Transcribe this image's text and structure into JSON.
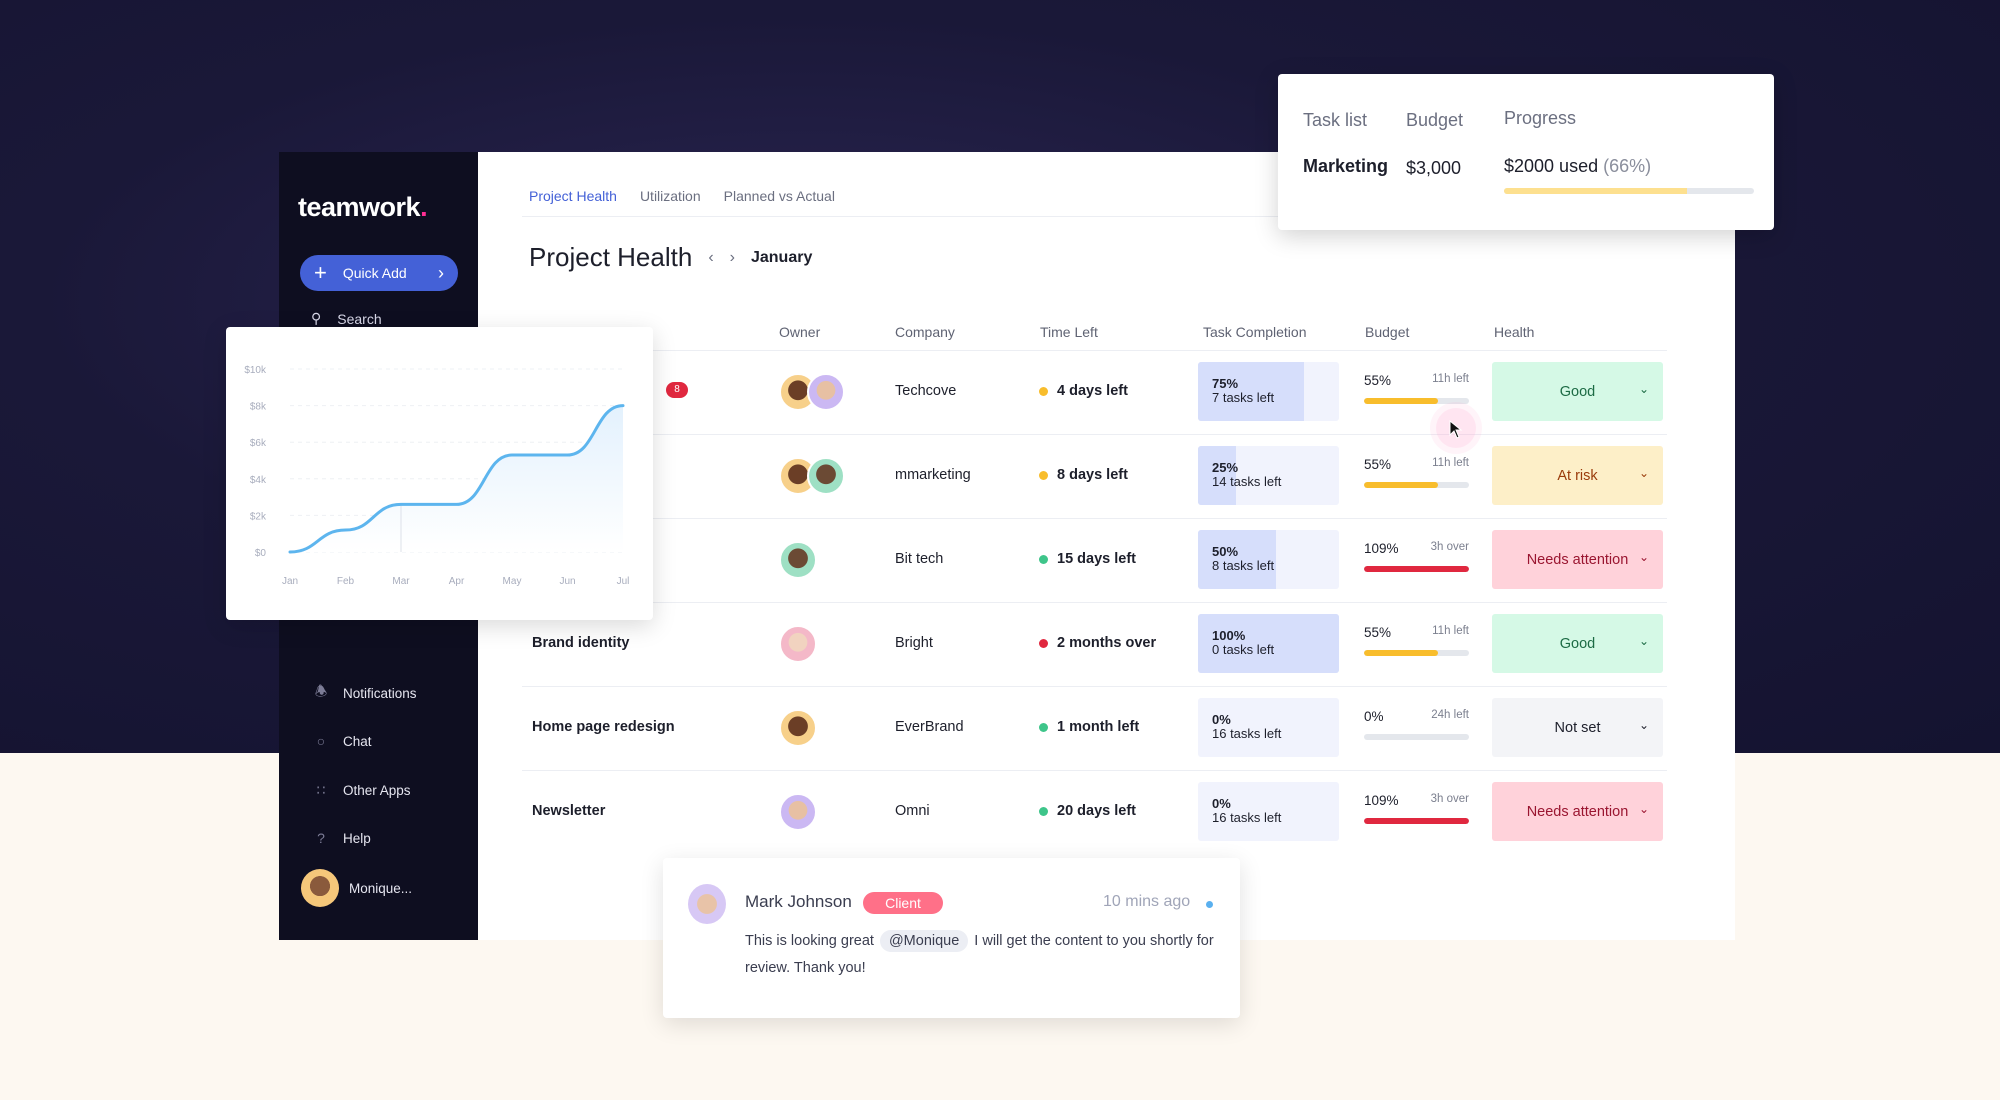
{
  "sidebar": {
    "logo": "teamwork",
    "logo_dot": ".",
    "quick_add": "Quick Add",
    "search": "Search",
    "items": [
      {
        "label": "Notifications",
        "icon": "bell-icon"
      },
      {
        "label": "Chat",
        "icon": "chat-icon"
      },
      {
        "label": "Other Apps",
        "icon": "grid-icon"
      },
      {
        "label": "Help",
        "icon": "help-icon"
      }
    ],
    "user": "Monique..."
  },
  "tabs": [
    {
      "label": "Project Health",
      "active": true
    },
    {
      "label": "Utilization"
    },
    {
      "label": "Planned vs Actual"
    }
  ],
  "title": "Project Health",
  "period": "January",
  "table": {
    "headers": [
      "Owner",
      "Company",
      "Time Left",
      "Task Completion",
      "Budget",
      "Health"
    ],
    "rows": [
      {
        "name": "",
        "badge": "8",
        "owners": 2,
        "company": "Techcove",
        "time": "4 days left",
        "time_color": "#f8bd2c",
        "tc_pct": "75%",
        "tc_fill": 75,
        "tc_left": "7 tasks left",
        "budget_pct": "55%",
        "budget_fill": 70,
        "budget_note": "11h left",
        "budget_color": "#f8bd2c",
        "health": "Good",
        "health_bg": "#d5f9e6",
        "health_fg": "#1c6b44"
      },
      {
        "name": "",
        "owners": 2,
        "company": "mmarketing",
        "time": "8 days left",
        "time_color": "#f8bd2c",
        "tc_pct": "25%",
        "tc_fill": 27,
        "tc_left": "14 tasks left",
        "budget_pct": "55%",
        "budget_fill": 70,
        "budget_note": "11h left",
        "budget_color": "#f8bd2c",
        "health": "At risk",
        "health_bg": "#fdefc8",
        "health_fg": "#9a3b0a"
      },
      {
        "name": "",
        "owners": 1,
        "company": "Bit tech",
        "time": "15 days left",
        "time_color": "#3ec58a",
        "tc_pct": "50%",
        "tc_fill": 55,
        "tc_left": "8 tasks left",
        "budget_pct": "109%",
        "budget_fill": 100,
        "budget_note": "3h over",
        "budget_color": "#e0283f",
        "health": "Needs attention",
        "health_bg": "#ffd2da",
        "health_fg": "#9a1530"
      },
      {
        "name": "Brand identity",
        "owners": 1,
        "company": "Bright",
        "time": "2 months over",
        "time_color": "#e0283f",
        "tc_pct": "100%",
        "tc_fill": 100,
        "tc_left": "0 tasks left",
        "budget_pct": "55%",
        "budget_fill": 70,
        "budget_note": "11h left",
        "budget_color": "#f8bd2c",
        "health": "Good",
        "health_bg": "#d5f9e6",
        "health_fg": "#1c6b44"
      },
      {
        "name": "Home page redesign",
        "owners": 1,
        "company": "EverBrand",
        "time": "1 month left",
        "time_color": "#3ec58a",
        "tc_pct": "0%",
        "tc_fill": 0,
        "tc_left": "16 tasks left",
        "budget_pct": "0%",
        "budget_fill": 0,
        "budget_note": "24h left",
        "budget_color": "#f8bd2c",
        "health": "Not set",
        "health_bg": "#f3f4f7",
        "health_fg": "#1d1f2b"
      },
      {
        "name": "Newsletter",
        "owners": 1,
        "company": "Omni",
        "time": "20 days left",
        "time_color": "#3ec58a",
        "tc_pct": "0%",
        "tc_fill": 0,
        "tc_left": "16 tasks left",
        "budget_pct": "109%",
        "budget_fill": 100,
        "budget_note": "3h over",
        "budget_color": "#e0283f",
        "health": "Needs attention",
        "health_bg": "#ffd2da",
        "health_fg": "#9a1530"
      }
    ]
  },
  "budget_card": {
    "headers": [
      "Task list",
      "Budget",
      "Progress"
    ],
    "task": "Marketing",
    "budget": "$3,000",
    "used": "$2000 used",
    "used_pct": "(66%)",
    "fill": 73
  },
  "chart_data": {
    "type": "area",
    "x": [
      "Jan",
      "Feb",
      "Mar",
      "Apr",
      "May",
      "Jun",
      "Jul"
    ],
    "values": [
      0,
      1200,
      2600,
      2600,
      5300,
      5300,
      8000
    ],
    "yticks": [
      "$0",
      "$2k",
      "$4k",
      "$6k",
      "$8k",
      "$10k"
    ],
    "ylim": [
      0,
      10000
    ],
    "grid": true,
    "color": "#5db5ee"
  },
  "chat": {
    "name": "Mark Johnson",
    "tag": "Client",
    "time": "10 mins ago",
    "msg_a": "This is looking great",
    "mention": "@Monique",
    "msg_b": "I will get the content to you shortly for review. Thank you!"
  }
}
